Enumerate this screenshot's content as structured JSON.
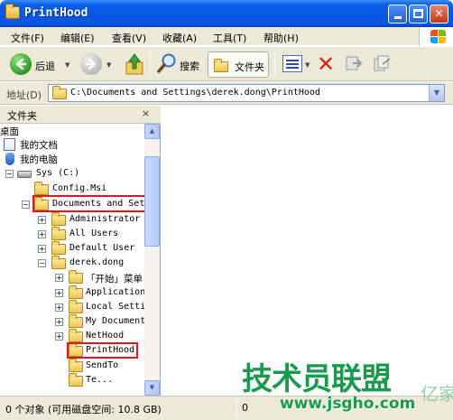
{
  "window": {
    "title": "PrintHood"
  },
  "menu": [
    "文件(F)",
    "编辑(E)",
    "查看(V)",
    "收藏(A)",
    "工具(T)",
    "帮助(H)"
  ],
  "toolbar": {
    "back": "后退",
    "search": "搜索",
    "folders": "文件夹"
  },
  "address": {
    "label": "地址(D)",
    "path": "C:\\Documents and Settings\\derek.dong\\PrintHood"
  },
  "folder_pane": {
    "title": "文件夹",
    "close": "×"
  },
  "tree": [
    {
      "label": "桌面"
    },
    {
      "label": "我的文档"
    },
    {
      "label": "我的电脑"
    },
    {
      "label": "Sys (C:)"
    },
    {
      "label": "Config.Msi"
    },
    {
      "label": "Documents and Set"
    },
    {
      "label": "Administrator"
    },
    {
      "label": "All Users"
    },
    {
      "label": "Default User"
    },
    {
      "label": "derek.dong"
    },
    {
      "label": "「开始」菜单"
    },
    {
      "label": "Application"
    },
    {
      "label": "Local Setti"
    },
    {
      "label": "My Document"
    },
    {
      "label": "NetHood"
    },
    {
      "label": "PrintHood"
    },
    {
      "label": "SendTo"
    },
    {
      "label": "Te..."
    }
  ],
  "status": {
    "objects": "0 个对象 (可用磁盘空间: 10.8 GB)",
    "size": "0"
  },
  "watermark": {
    "text": "技术员联盟",
    "url": "www.jsgho.com",
    "extra": "亿家"
  },
  "colors": {
    "titlebar": "#0655e0",
    "chrome": "#ece9d8",
    "highlight": "#e0151e"
  }
}
